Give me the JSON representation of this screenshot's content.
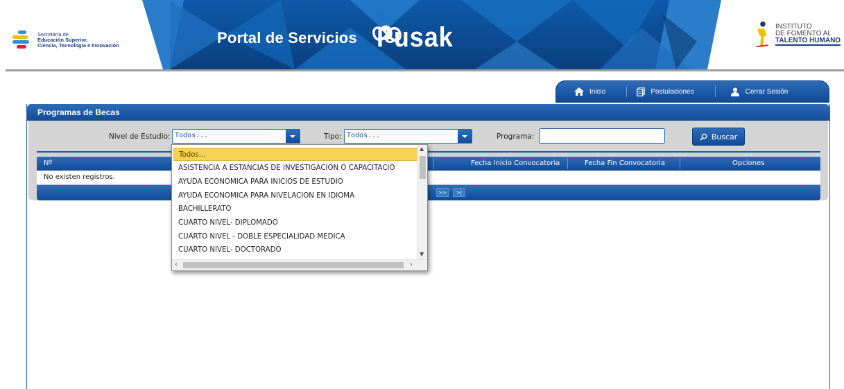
{
  "header": {
    "left_logo": {
      "lines": [
        "Secretaría de",
        "Educación Superior,",
        "Ciencia, Tecnología e Innovación"
      ]
    },
    "banner_title": "Portal de Servicios",
    "brand_name": "Pusak",
    "right_logo": {
      "lines": [
        "INSTITUTO",
        "DE FOMENTO AL",
        "TALENTO HUMANO"
      ]
    }
  },
  "nav": {
    "items": [
      {
        "label": "Inicio",
        "icon": "home-icon"
      },
      {
        "label": "Postulaciones",
        "icon": "documents-icon"
      },
      {
        "label": "Cerrar Sesión",
        "icon": "user-icon"
      }
    ]
  },
  "panel": {
    "title": "Programas de Becas"
  },
  "filters": {
    "nivel_label": "Nivel de Estudio:",
    "nivel_value": "Todos...",
    "tipo_label": "Tipo:",
    "tipo_value": "Todos...",
    "programa_label": "Programa:",
    "programa_value": "",
    "search_button": "Buscar"
  },
  "grid": {
    "columns": [
      "Nº",
      "Fecha Inicio Convocatoria",
      "Fecha Fin Convocatoria",
      "Opciones"
    ],
    "empty_message": "No existen registros.",
    "pager": [
      ">>",
      ">|"
    ]
  },
  "dropdown": {
    "selected_index": 0,
    "options": [
      "Todos...",
      "ASISTENCIA A ESTANCIAS DE INVESTIGACION O CAPACITACIO",
      "AYUDA ECONOMICA PARA INICIOS DE ESTUDIO",
      "AYUDA ECONOMICA PARA NIVELACION EN IDIOMA",
      "BACHILLERATO",
      "CUARTO NIVEL- DIPLOMADO",
      "CUARTO NIVEL - DOBLE ESPECIALIDAD MEDICA",
      "CUARTO NIVEL- DOCTORADO"
    ]
  },
  "colors": {
    "primary_blue": "#114b99",
    "selected_yellow": "#f6d155",
    "panel_gray": "#d4d4d4"
  }
}
